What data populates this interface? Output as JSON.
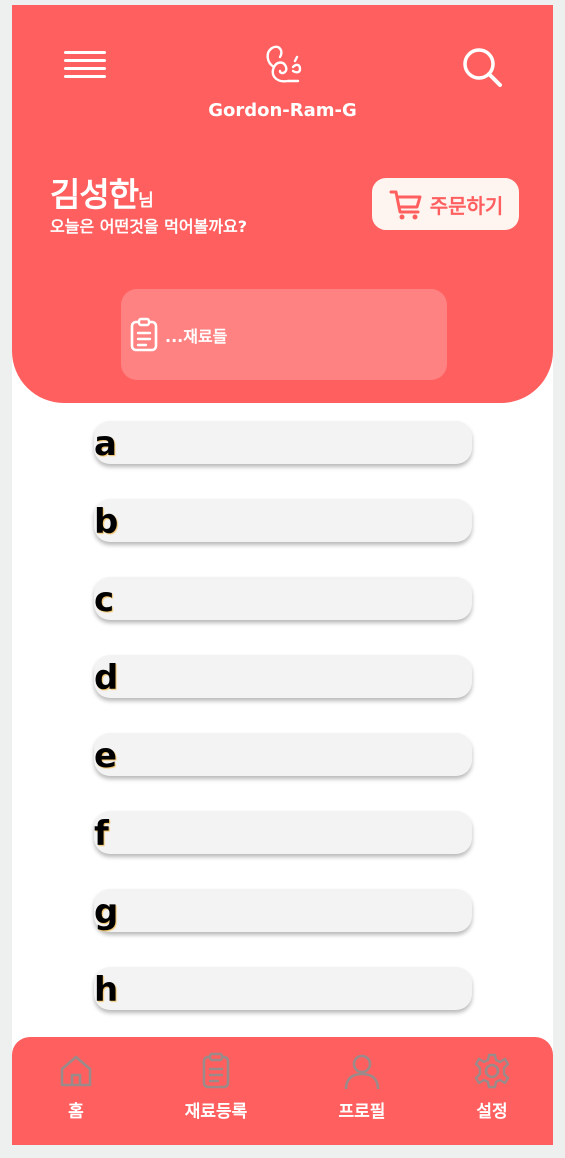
{
  "header": {
    "brand": "Gordon-Ram-G",
    "user_name": "김성한",
    "user_suffix": "님",
    "question": "오늘은 어떤것을 먹어볼까요?",
    "order_label": "주문하기",
    "ingredients_label": "...재료들"
  },
  "list": {
    "items": [
      {
        "label": "a"
      },
      {
        "label": "b"
      },
      {
        "label": "c"
      },
      {
        "label": "d"
      },
      {
        "label": "e"
      },
      {
        "label": "f"
      },
      {
        "label": "g"
      },
      {
        "label": "h"
      }
    ]
  },
  "nav": {
    "items": [
      {
        "label": "홈",
        "icon": "home-icon"
      },
      {
        "label": "재료등록",
        "icon": "clipboard-icon"
      },
      {
        "label": "프로필",
        "icon": "user-icon"
      },
      {
        "label": "설정",
        "icon": "gear-icon"
      }
    ]
  },
  "colors": {
    "primary": "#ff5f5f",
    "ingredients_box": "#ff8282",
    "list_item_bg": "#f3f3f3",
    "order_button_bg": "#fff5f0",
    "nav_icon": "#9a8a8a"
  }
}
